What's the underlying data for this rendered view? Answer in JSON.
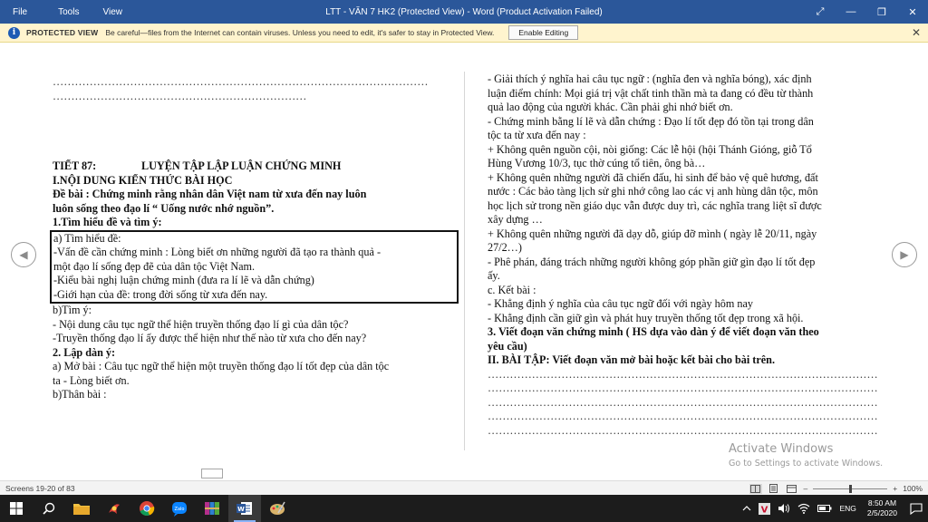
{
  "titlebar": {
    "menu": [
      "File",
      "Tools",
      "View"
    ],
    "title": "LTT - VĂN 7 HK2 (Protected View) - Word (Product Activation Failed)",
    "controls": [
      "⤢",
      "—",
      "❐",
      "✕"
    ]
  },
  "protected_view": {
    "label": "PROTECTED VIEW",
    "message": "Be careful—files from the Internet can contain viruses. Unless you need to edit, it's safer to stay in Protected View.",
    "button": "Enable Editing",
    "close": "✕"
  },
  "nav": {
    "left": "◀",
    "right": "▶"
  },
  "left_page": {
    "dots1": "…………………………………………………………………………………………",
    "dots2": "……………………………………………………………",
    "title_a": "TIẾT 87:",
    "title_b": "LUYỆN TẬP LẬP LUẬN CHỨNG MINH",
    "l1": "I.NỘI DUNG KIẾN THỨC BÀI HỌC",
    "l2": "Đề bài : Chứng minh rằng nhân dân Việt nam từ xưa đến nay luôn",
    "l3": "luôn sống theo đạo lí “ Uống nước nhớ nguồn”.",
    "l4": "1.Tìm hiểu đề và tìm ý:",
    "l5": "a) Tìm hiểu đề:",
    "l6": "-Vấn đề cần chứng minh : Lòng biết ơn những người đã tạo ra thành quả -",
    "l7": "một đạo lí sống đẹp đẽ của dân tộc Việt Nam.",
    "l8": "-Kiểu bài nghị luận chứng minh (đưa ra lí lẽ và dẫn chứng)",
    "l9": "-Giới hạn của đề: trong đời sống từ xưa đến nay.",
    "l10": "b)Tìm ý:",
    "l11": "-  Nội dung câu tục ngữ thể hiện truyền thống đạo lí gì của dân tộc?",
    "l12": "-Truyền thống đạo lí ấy được thể hiện như thế nào từ xưa cho đến nay?",
    "l13": "2. Lập dàn ý:",
    "l14": " a) Mở bài : Câu tục ngữ thể hiện một truyền thống đạo lí tốt đẹp của dân tộc",
    "l15": " ta - Lòng biết ơn.",
    "l16": "  b)Thân bài :"
  },
  "right_page": {
    "r1": " - Giải thích ý nghĩa hai câu tục ngữ :  (nghĩa đen và nghĩa bóng), xác định",
    "r2": "luận điểm chính: Mọi giá trị vật chất tinh thần mà ta đang có đều từ thành",
    "r3": "quả lao động của người khác. Cần phải ghi nhớ biết ơn.",
    "r4": "- Chứng minh bằng lí lẽ và dẫn chứng : Đạo lí tốt đẹp đó tồn tại trong dân",
    "r5": "tộc ta từ xưa đến nay :",
    "r6": "+ Không quên nguồn cội, nòi giống: Các lễ hội (hội Thánh Gióng, giỗ Tổ",
    "r7": "Hùng Vương 10/3, tục thờ cúng tổ tiên, ông bà…",
    "r8": "+ Không quên những người đã chiến đấu, hi sinh để bảo vệ quê hương, đất",
    "r9": "nước : Các bảo tàng lịch sử ghi nhớ công lao các vị anh hùng dân tộc, môn",
    "r10": "học lịch sử trong nền giáo dục vẫn được duy trì, các nghĩa trang liệt sĩ được",
    "r11": "xây dựng …",
    "r12": "+ Không quên những người đã dạy dỗ, giúp đỡ mình ( ngày lễ 20/11, ngày",
    "r13": "27/2…)",
    "r14": " - Phê phán, đáng trách những người không góp phần giữ gìn đạo lí tốt đẹp",
    "r15": "ấy.",
    "r16": "   c. Kết bài :",
    "r17": "-   Khẳng định ý nghĩa của câu tục ngữ đối với ngày hôm  nay",
    "r18": "-   Khẳng định  cần giữ gìn và phát huy truyền thống tốt đẹp trong xã hội.",
    "r19": "3. Viết đoạn văn chứng minh ( HS dựa vào dàn ý để viết đoạn văn theo",
    "r20": "yêu cầu)",
    "r21": "II. BÀI TẬP: Viết đoạn văn mở bài hoặc kết bài cho bài trên.",
    "dots": "…………………………………………………………………………………………………"
  },
  "watermark": {
    "line1": "Activate Windows",
    "line2": "Go to Settings to activate Windows."
  },
  "statusbar": {
    "screens": "Screens 19-20 of 83",
    "zoom": "100%",
    "minus": "–",
    "plus": "+"
  },
  "taskbar": {
    "lang": "ENG",
    "time": "8:50 AM",
    "date": "2/5/2020"
  }
}
